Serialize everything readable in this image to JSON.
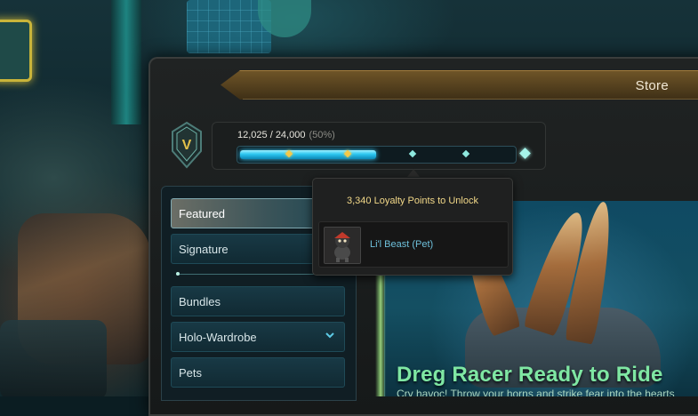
{
  "store": {
    "title": "Store"
  },
  "loyalty": {
    "tier_letter": "V",
    "progress_text": "12,025 / 24,000",
    "percent_text": "(50%)",
    "progress_fraction": 0.5
  },
  "tooltip": {
    "heading": "3,340 Loyalty Points to Unlock",
    "reward_name": "Li'l Beast (Pet)"
  },
  "nav": {
    "items": [
      {
        "label": "Featured",
        "active": true
      },
      {
        "label": "Signature"
      },
      {
        "label": "Bundles"
      },
      {
        "label": "Holo-Wardrobe",
        "has_chevron": true
      },
      {
        "label": "Pets"
      }
    ]
  },
  "banner": {
    "title": "Dreg Racer Ready to Ride",
    "subtitle": "Cry havoc! Throw your horns and strike fear into the hearts"
  },
  "colors": {
    "accent": "#2bc6f0",
    "gold": "#f3c94a",
    "banner_title": "#7fe7a3"
  }
}
